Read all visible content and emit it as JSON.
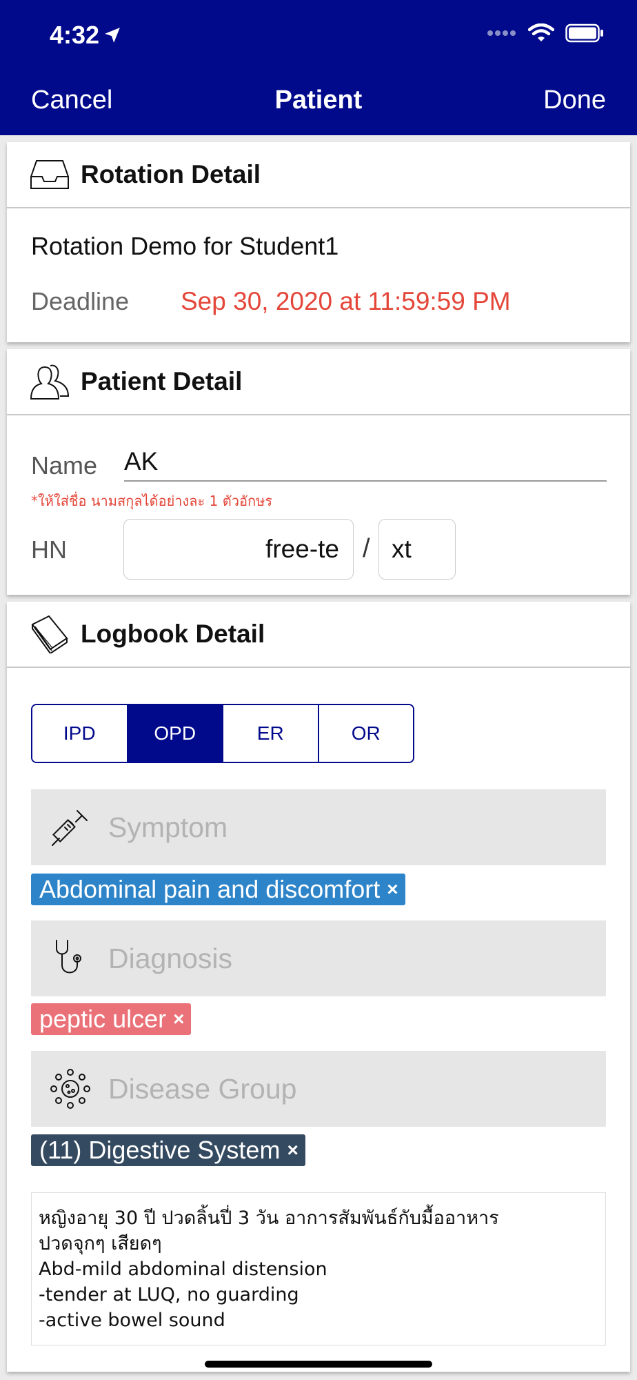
{
  "status_bar": {
    "time": "4:32"
  },
  "nav": {
    "cancel_label": "Cancel",
    "title": "Patient",
    "done_label": "Done"
  },
  "rotation": {
    "header": "Rotation Detail",
    "name": "Rotation Demo for Student1",
    "deadline_label": "Deadline",
    "deadline_value": "Sep 30, 2020 at 11:59:59 PM"
  },
  "patient": {
    "header": "Patient Detail",
    "name_label": "Name",
    "name_value": "AK",
    "name_hint": "*ให้ใส่ชื่อ นามสกุลได้อย่างละ 1 ตัวอักษร",
    "hn_label": "HN",
    "hn_value_1": "free-te",
    "hn_separator": "/",
    "hn_value_2": "xt"
  },
  "logbook": {
    "header": "Logbook Detail",
    "segments": [
      "IPD",
      "OPD",
      "ER",
      "OR"
    ],
    "selected_segment": "OPD",
    "symptom_placeholder": "Symptom",
    "symptom_tag": "Abdominal pain and discomfort",
    "diagnosis_placeholder": "Diagnosis",
    "diagnosis_tag": "peptic ulcer",
    "disease_group_placeholder": "Disease Group",
    "disease_group_tag": "(11) Digestive System",
    "tag_remove_glyph": "×",
    "notes": "หญิงอายุ 30 ปี ปวดลิ้นปี่ 3 วัน อาการสัมพันธ์กับมื้ออาหาร\nปวดจุกๆ เสียดๆ\nAbd-mild abdominal distension\n-tender at LUQ, no guarding\n-active bowel sound"
  },
  "colors": {
    "nav_background": "#020a8c",
    "deadline": "#e4473a",
    "symptom_tag": "#2d84c8",
    "diagnosis_tag": "#ea7178",
    "disease_group_tag": "#344a60"
  }
}
